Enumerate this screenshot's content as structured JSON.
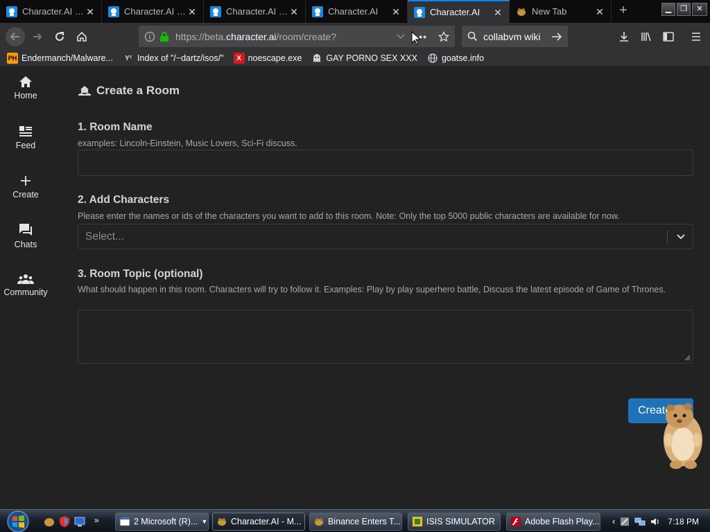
{
  "browser": {
    "tabs": [
      {
        "title": "Character.AI - L",
        "active": false
      },
      {
        "title": "Character.AI - C",
        "active": false
      },
      {
        "title": "Character.AI - S",
        "active": false
      },
      {
        "title": "Character.AI",
        "active": false
      },
      {
        "title": "Character.AI",
        "active": true
      },
      {
        "title": "New Tab",
        "active": false
      }
    ],
    "url_prefix": "https://beta.",
    "url_host": "character.ai",
    "url_path": "/room/create?",
    "search_text": "collabvm wiki",
    "bookmarks": [
      {
        "label": "Endermanch/Malware...",
        "icon": "pornhub-icon"
      },
      {
        "label": "Index of \"/~dartz/isos/\"",
        "icon": "yc-icon"
      },
      {
        "label": "noescape.exe",
        "icon": "x-icon"
      },
      {
        "label": "GAY PORNO SEX XXX",
        "icon": "ghost-icon"
      },
      {
        "label": "goatse.info",
        "icon": "globe-icon"
      }
    ]
  },
  "sidebar": {
    "items": [
      {
        "label": "Home",
        "icon": "home-icon"
      },
      {
        "label": "Feed",
        "icon": "feed-icon"
      },
      {
        "label": "Create",
        "icon": "plus-icon"
      },
      {
        "label": "Chats",
        "icon": "chats-icon"
      },
      {
        "label": "Community",
        "icon": "community-icon"
      }
    ]
  },
  "form": {
    "title": "Create a Room",
    "room_name": {
      "label": "1. Room Name",
      "hint": "examples: Lincoln-Einstein, Music Lovers, Sci-Fi discuss.",
      "value": ""
    },
    "characters": {
      "label": "2. Add Characters",
      "hint": "Please enter the names or ids of the characters you want to add to this room. Note: Only the top 5000 public characters are available for now.",
      "placeholder": "Select..."
    },
    "topic": {
      "label": "3. Room Topic (optional)",
      "hint": "What should happen in this room. Characters will try to follow it. Examples: Play by play superhero battle, Discuss the latest episode of Game of Thrones.",
      "value": ""
    },
    "submit_label": "Create It!"
  },
  "taskbar": {
    "tasks": [
      {
        "label": "2 Microsoft (R)...",
        "icon": "window-icon",
        "active": false
      },
      {
        "label": "Character.AI - M...",
        "icon": "firefox-icon",
        "active": true
      },
      {
        "label": "Binance Enters T...",
        "icon": "firefox-icon",
        "active": false
      },
      {
        "label": "ISIS SIMULATOR",
        "icon": "game-icon",
        "active": false
      },
      {
        "label": "Adobe Flash Play...",
        "icon": "flash-icon",
        "active": false
      }
    ],
    "clock": "7:18 PM"
  },
  "colors": {
    "accent": "#0a84ff",
    "create_button": "#1e73b8",
    "page_bg": "#222223"
  }
}
